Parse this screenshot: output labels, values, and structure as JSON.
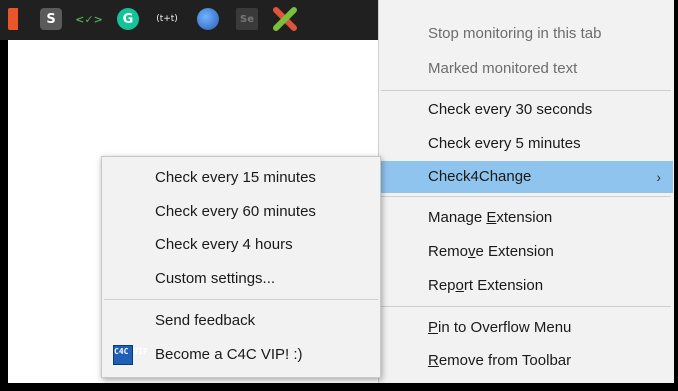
{
  "toolbar": {
    "icons": [
      {
        "name": "orange-extension-icon"
      },
      {
        "name": "s-extension-icon",
        "glyph": "S"
      },
      {
        "name": "code-extension-icon",
        "glyph": "<✓>"
      },
      {
        "name": "grammarly-icon",
        "glyph": "G"
      },
      {
        "name": "text-extension-icon",
        "glyph": "(t+t)"
      },
      {
        "name": "globe-extension-icon"
      },
      {
        "name": "selenium-extension-icon",
        "glyph": "Se"
      },
      {
        "name": "check4change-x-icon"
      }
    ]
  },
  "context_menu": {
    "stop_monitoring": "Stop monitoring in this tab",
    "marked_text": "Marked monitored text",
    "check_30s": "Check every 30 seconds",
    "check_5m": "Check every 5 minutes",
    "check4change": "Check4Change",
    "manage_pre": "Manage ",
    "manage_u": "E",
    "manage_post": "xtension",
    "remove_pre": "Remo",
    "remove_u": "v",
    "remove_post": "e Extension",
    "report_pre": "Rep",
    "report_u": "o",
    "report_post": "rt Extension",
    "pin_u": "P",
    "pin_post": "in to Overflow Menu",
    "remove_tb_u": "R",
    "remove_tb_post": "emove from Toolbar"
  },
  "submenu": {
    "check_15m": "Check every 15 minutes",
    "check_60m": "Check every 60 minutes",
    "check_4h": "Check every 4 hours",
    "custom": "Custom settings...",
    "feedback": "Send feedback",
    "vip": "Become a C4C VIP! :)",
    "vip_icon_text": "C4C VIP"
  },
  "colors": {
    "hover": "#8fc4ee",
    "menu_bg": "#f2f2f2",
    "toolbar_bg": "#202020"
  }
}
